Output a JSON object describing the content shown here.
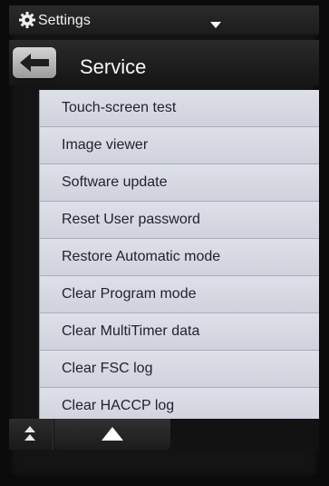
{
  "header": {
    "title": "Settings",
    "icon": "gear-icon"
  },
  "titlebar": {
    "title": "Service",
    "back_icon": "arrow-left-icon"
  },
  "menu": {
    "items": [
      {
        "label": "Touch-screen test"
      },
      {
        "label": "Image viewer"
      },
      {
        "label": "Software update"
      },
      {
        "label": "Reset User password"
      },
      {
        "label": "Restore Automatic mode"
      },
      {
        "label": "Clear Program mode"
      },
      {
        "label": "Clear MultiTimer data"
      },
      {
        "label": "Clear FSC log"
      },
      {
        "label": "Clear HACCP log"
      }
    ]
  },
  "bottom_nav": {
    "scroll_top_icon": "double-chevron-up-icon",
    "scroll_up_icon": "triangle-up-icon"
  },
  "colors": {
    "list_background": "#d6d8e0",
    "list_text": "#202230",
    "chrome_background": "#141414"
  }
}
